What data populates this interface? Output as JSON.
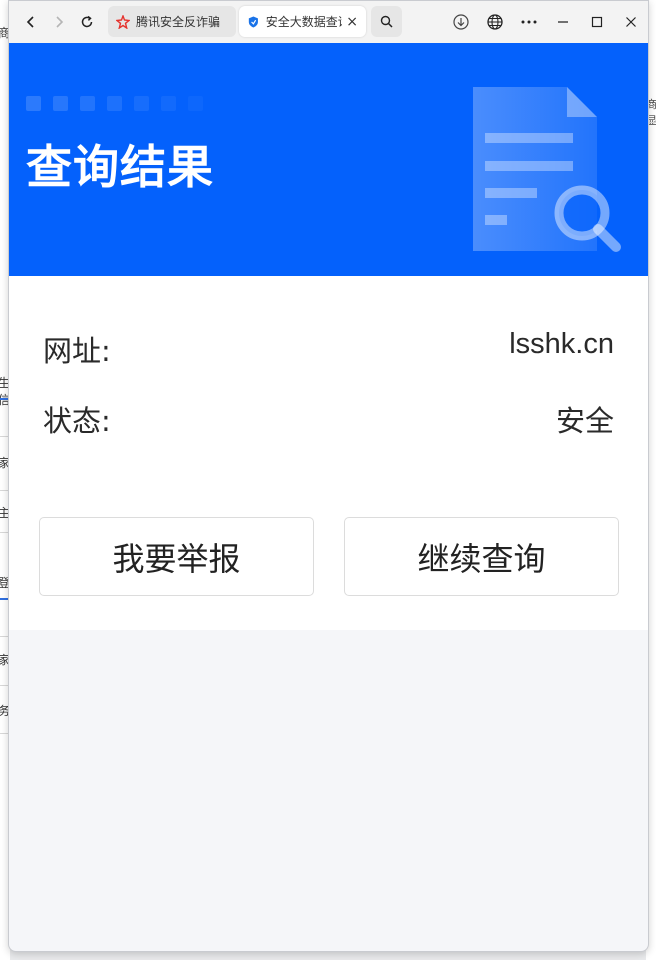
{
  "browser": {
    "tabs": [
      {
        "title": "腾讯安全反诈骗实验室",
        "active": false,
        "icon": "tencent-antifraud-icon"
      },
      {
        "title": "安全大数据查询",
        "active": true,
        "icon": "shield-icon"
      }
    ],
    "close_tab_label": "×"
  },
  "page": {
    "hero_title": "查询结果",
    "rows": [
      {
        "label": "网址:",
        "value": "lsshk.cn"
      },
      {
        "label": "状态:",
        "value": "安全"
      }
    ],
    "buttons": {
      "report": "我要举报",
      "continue": "继续查询"
    }
  },
  "background_fragments": {
    "left": [
      "商",
      "生信",
      "家",
      "主",
      "登",
      "家",
      "务"
    ],
    "right": [
      "商显"
    ]
  },
  "colors": {
    "hero_blue": "#0461fc",
    "page_bg": "#f5f6f9"
  }
}
